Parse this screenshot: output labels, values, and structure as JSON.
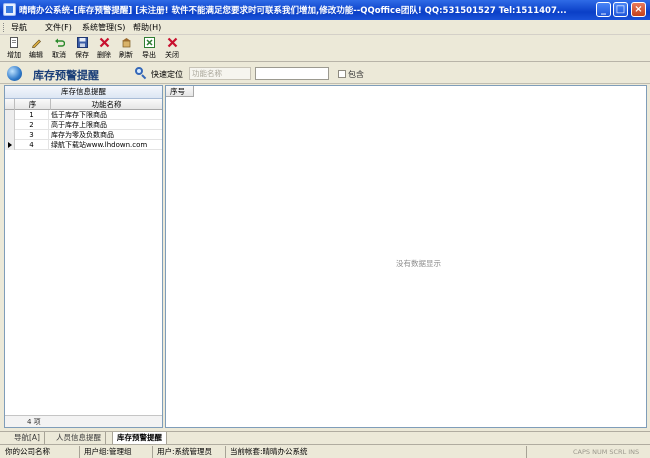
{
  "window": {
    "title": "晴晴办公系统-[库存预警提醒]   [未注册! 软件不能满足您要求时可联系我们增加,修改功能--QQoffice团队! QQ:531501527 Tel:1511407..."
  },
  "menu": {
    "items": [
      "导航",
      "文件(F)",
      "系统管理(S)",
      "帮助(H)"
    ]
  },
  "toolbar": {
    "buttons": [
      {
        "label": "增加",
        "icon": "add-document-icon"
      },
      {
        "label": "编辑",
        "icon": "edit-pencil-icon"
      },
      {
        "label": "取消",
        "icon": "undo-arrow-icon"
      },
      {
        "label": "保存",
        "icon": "save-disk-icon"
      },
      {
        "label": "删除",
        "icon": "delete-x-icon"
      },
      {
        "label": "刷新",
        "icon": "refresh-icon"
      },
      {
        "label": "导出",
        "icon": "export-icon"
      },
      {
        "label": "关闭",
        "icon": "close-x-icon"
      }
    ]
  },
  "header": {
    "title": "库存预警提醒",
    "quick_locate_label": "快速定位",
    "field_select": "功能名称",
    "search_value": "",
    "contain_label": "包含"
  },
  "left_panel": {
    "title": "库存信息提醒",
    "columns": [
      "序",
      "功能名称"
    ],
    "rows": [
      {
        "index": "1",
        "name": "低于库存下限商品"
      },
      {
        "index": "2",
        "name": "高于库存上限商品"
      },
      {
        "index": "3",
        "name": "库存为零及负数商品"
      },
      {
        "index": "4",
        "name": "绿航下载站www.lhdown.com"
      }
    ],
    "selected_row": 3,
    "footer_count": "4 项"
  },
  "right_panel": {
    "column_header": "序号",
    "empty_message": "没有数据显示"
  },
  "tabs": [
    {
      "label": "导航[A]",
      "active": false
    },
    {
      "label": "人员信息提醒",
      "active": false
    },
    {
      "label": "库存预警提醒",
      "active": true
    }
  ],
  "status": {
    "company": "你的公司名称",
    "user_group": "用户组:管理组",
    "user": "用户:系统管理员",
    "account": "当前帐套:晴晴办公系统",
    "keys": "CAPS NUM SCRL INS"
  },
  "colors": {
    "titlebar": "#0A3FC7",
    "accent_title": "#1A3E78",
    "delete_red": "#C8102E"
  }
}
